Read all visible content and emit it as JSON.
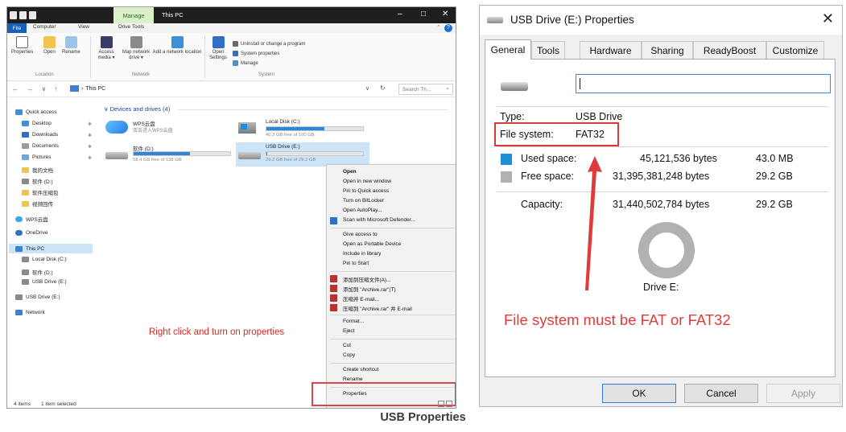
{
  "explorer": {
    "title": "This PC",
    "manage_tab": "Manage",
    "ribbon_tabs": [
      "File",
      "Computer",
      "View",
      "Drive Tools"
    ],
    "ribbon": {
      "properties": "Properties",
      "open": "Open",
      "rename": "Rename",
      "access_media": "Access media ▾",
      "map_network_drive": "Map network drive ▾",
      "add_network_location": "Add a network location",
      "open_settings": "Open Settings",
      "uninstall": "Uninstall or change a program",
      "system_properties": "System properties",
      "manage": "Manage",
      "group_location": "Location",
      "group_network": "Network",
      "group_system": "System"
    },
    "address": {
      "path": "This PC",
      "search_placeholder": "Search Th..."
    },
    "nav": {
      "quick_access": "Quick access",
      "desktop": "Desktop",
      "downloads": "Downloads",
      "documents": "Documents",
      "pictures": "Pictures",
      "folder_1": "我的文档",
      "folder_2": "软件 (D:)",
      "folder_3": "软件压缩包",
      "folder_4": "视频回传",
      "wps_cloud": "WPS云盘",
      "onedrive": "OneDrive",
      "this_pc": "This PC",
      "local_disk": "Local Disk (C:)",
      "software_d": "软件 (D:)",
      "usb_drive": "USB Drive (E:)",
      "usb_drive_2": "USB Drive (E:)",
      "network": "Network"
    },
    "group_header": "Devices and drives (4)",
    "drives": {
      "wps": {
        "name": "WPS云盘",
        "sub": "双击进入WPS云盘"
      },
      "c": {
        "name": "Local Disk (C:)",
        "free": "40.3 GB free of 100 GB",
        "used_fraction": 0.6
      },
      "d": {
        "name": "软件 (D:)",
        "free": "58.4 GB free of 138 GB",
        "used_fraction": 0.58
      },
      "e": {
        "name": "USB Drive (E:)",
        "free": "29.2 GB free of 29.2 GB",
        "used_fraction": 0.01
      }
    },
    "context_menu": {
      "open": "Open",
      "open_new_window": "Open in new window",
      "pin_quick": "Pin to Quick access",
      "bitlocker": "Turn on BitLocker",
      "autoplay": "Open AutoPlay...",
      "defender": "Scan with Microsoft Defender...",
      "give_access": "Give access to",
      "portable": "Open as Portable Device",
      "include_library": "Include in library",
      "pin_start": "Pin to Start",
      "rar_add": "添加到压缩文件(A)...",
      "rar_archive": "添加到 \"Archive.rar\"(T)",
      "rar_email": "压缩并 E-mail...",
      "rar_archive_email": "压缩到 \"Archive.rar\" 并 E-mail",
      "format": "Format...",
      "eject": "Eject",
      "cut": "Cut",
      "copy": "Copy",
      "create_shortcut": "Create shortcut",
      "rename": "Rename",
      "properties": "Properties"
    },
    "annotation": "Right click and turn on properties",
    "status": {
      "items": "4 items",
      "selected": "1 item selected"
    }
  },
  "dialog": {
    "title": "USB Drive (E:) Properties",
    "close": "✕",
    "tabs": [
      "General",
      "Tools",
      "Hardware",
      "Sharing",
      "ReadyBoost",
      "Customize"
    ],
    "name_value": "",
    "type_label": "Type:",
    "type_value": "USB Drive",
    "fs_label": "File system:",
    "fs_value": "FAT32",
    "used_label": "Used space:",
    "used_bytes": "45,121,536 bytes",
    "used_size": "43.0 MB",
    "free_label": "Free space:",
    "free_bytes": "31,395,381,248 bytes",
    "free_size": "29.2 GB",
    "capacity_label": "Capacity:",
    "capacity_bytes": "31,440,502,784 bytes",
    "capacity_size": "29.2 GB",
    "drive_label": "Drive E:",
    "warning": "File system must be FAT or FAT32",
    "ok": "OK",
    "cancel": "Cancel",
    "apply": "Apply",
    "colors": {
      "used": "#1e8fd6",
      "free": "#b1b1b1",
      "annotation": "#e03b3b"
    }
  },
  "caption": "USB Properties"
}
